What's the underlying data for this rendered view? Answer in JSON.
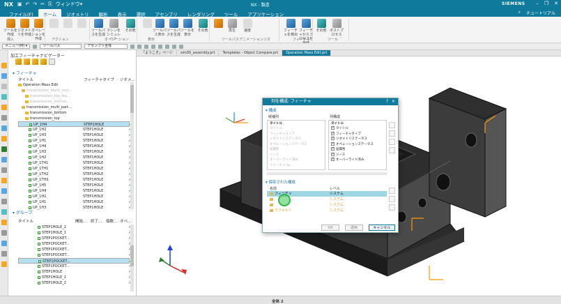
{
  "titlebar": {
    "logo": "NX",
    "window_menu": "ウィンドウ▾",
    "title": "NX - 製造",
    "brand": "SIEMENS"
  },
  "menu": {
    "tabs": [
      "ファイル(F)",
      "ホーム",
      "ジオメトリ",
      "解析",
      "表示",
      "選択",
      "アセンブリ",
      "レンダリング",
      "ツール",
      "アプリケーション"
    ],
    "active_index": 1,
    "right_tutorial": "チュートリアル"
  },
  "ribbon": {
    "buttons": [
      {
        "label": "ツールを作成",
        "color": "orange"
      },
      {
        "label": "ジオメトリを作成",
        "color": "orange"
      },
      {
        "label": "オペレーションを作成",
        "color": "orange"
      },
      {
        "label": "",
        "color": "dim"
      },
      {
        "label": "",
        "color": "dim"
      },
      {
        "label": "",
        "color": "dim"
      },
      {
        "label": "ツールパスを生成",
        "color": "blue"
      },
      {
        "label": "マシンをシミュレート",
        "color": "grey"
      },
      {
        "label": "その他",
        "color": "teal"
      },
      {
        "label": "",
        "color": "dim"
      },
      {
        "label": "ツールパス表示",
        "color": "blue"
      },
      {
        "label": "ツールパスを生成",
        "color": "blue"
      },
      {
        "label": "ツールを表示",
        "color": "blue"
      },
      {
        "label": "その他",
        "color": "teal"
      },
      {
        "label": "",
        "color": "orange"
      },
      {
        "label": "再生",
        "color": "grey"
      },
      {
        "label": "速度",
        "color": "dim"
      },
      {
        "label": "フィーチャを検出",
        "color": "blue"
      },
      {
        "label": "フィーチャからプロセスを作成",
        "color": "blue"
      },
      {
        "label": "その他",
        "color": "teal"
      },
      {
        "label": "ポストプロセス",
        "color": "grey"
      }
    ],
    "groups": [
      "挿入",
      "アクション",
      "オペレーション",
      "表示",
      "ツールパスアニメーション",
      "ジオ",
      "フィーチャ",
      "ツール"
    ]
  },
  "filterbar": {
    "menu_label": "メニュー(M) ▾",
    "filter_value": "ツールパス",
    "assembly_value": "アセンブリ全体"
  },
  "navigator": {
    "title": "加工フィーチャナビゲーター",
    "feature_section": "フィーチャ",
    "columns": {
      "name": "タイトル",
      "type": "フィーチャタイプ",
      "status": "ジオメ..."
    },
    "rows": [
      {
        "name": "Operation Mass Edit",
        "type": "",
        "style": "normal",
        "indent": 0,
        "check": false,
        "selected": false
      },
      {
        "name": "transmission_blank_mul...",
        "type": "",
        "style": "dim",
        "indent": 1,
        "check": false,
        "selected": false
      },
      {
        "name": "transmission_top_bla...",
        "type": "",
        "style": "dim",
        "indent": 2,
        "check": false,
        "selected": false
      },
      {
        "name": "transmission_bottom...",
        "type": "",
        "style": "dim",
        "indent": 2,
        "check": false,
        "selected": false
      },
      {
        "name": "transmission_multi_part...",
        "type": "",
        "style": "normal",
        "indent": 1,
        "check": false,
        "selected": false
      },
      {
        "name": "transmission_bottom",
        "type": "",
        "style": "normal",
        "indent": 2,
        "check": false,
        "selected": false
      },
      {
        "name": "transmission_top",
        "type": "",
        "style": "normal",
        "indent": 2,
        "check": false,
        "selected": false
      },
      {
        "name": "UP_1H4",
        "type": "STEP1HOLE",
        "style": "normal",
        "indent": 3,
        "check": true,
        "selected": true
      },
      {
        "name": "UP_1H2",
        "type": "STEP1HOLE",
        "style": "normal",
        "indent": 3,
        "check": true,
        "selected": false
      },
      {
        "name": "UP_1H3",
        "type": "STEP1HOLE",
        "style": "normal",
        "indent": 3,
        "check": true,
        "selected": false
      },
      {
        "name": "UP_1H1",
        "type": "STEP1HOLE",
        "style": "normal",
        "indent": 3,
        "check": true,
        "selected": false
      },
      {
        "name": "UP_1H4",
        "type": "STEP1HOLE",
        "style": "normal",
        "indent": 3,
        "check": true,
        "selected": false
      },
      {
        "name": "UP_1H3",
        "type": "STEP1HOLE",
        "style": "normal",
        "indent": 3,
        "check": true,
        "selected": false
      },
      {
        "name": "UP_1H2",
        "type": "STEP1HOLE",
        "style": "normal",
        "indent": 3,
        "check": true,
        "selected": false
      },
      {
        "name": "UP_1TH1",
        "type": "STEP1HOLE",
        "style": "normal",
        "indent": 3,
        "check": true,
        "selected": false
      },
      {
        "name": "UP_1TH1",
        "type": "STEP1HOLE",
        "style": "normal",
        "indent": 3,
        "check": true,
        "selected": false
      },
      {
        "name": "UP_1TH2",
        "type": "STEP1HOLE",
        "style": "normal",
        "indent": 3,
        "check": true,
        "selected": false
      },
      {
        "name": "UP_1TH3",
        "type": "STEP1HOLE",
        "style": "normal",
        "indent": 3,
        "check": true,
        "selected": false
      },
      {
        "name": "UP_1H5",
        "type": "STEP1HOLE",
        "style": "normal",
        "indent": 3,
        "check": true,
        "selected": false
      },
      {
        "name": "UP_1H4",
        "type": "STEP1HOLE",
        "style": "normal",
        "indent": 3,
        "check": true,
        "selected": false
      },
      {
        "name": "UP_1H2",
        "type": "STEP1HOLE",
        "style": "normal",
        "indent": 3,
        "check": true,
        "selected": false
      },
      {
        "name": "UP_1H1",
        "type": "STEP1HOLE",
        "style": "normal",
        "indent": 3,
        "check": true,
        "selected": false
      },
      {
        "name": "UP_1H3",
        "type": "STEP1HOLE",
        "style": "normal",
        "indent": 3,
        "check": true,
        "selected": false
      }
    ],
    "group_section": "グループ",
    "group_columns": {
      "name": "タイトル",
      "c1": "開始...",
      "c2": "終了...",
      "c3": "個数...",
      "c4": "オペ..."
    },
    "group_rows": [
      {
        "name": "STEP1HOLE_2",
        "selected": false
      },
      {
        "name": "STEP1HOLE_1",
        "selected": false
      },
      {
        "name": "STEP1POCKET...",
        "selected": false
      },
      {
        "name": "STEP1POCKET...",
        "selected": false
      },
      {
        "name": "STEP1POCKET...",
        "selected": false
      },
      {
        "name": "STEP1POCKET...",
        "selected": false
      },
      {
        "name": "STEP1POCKET...",
        "selected": true
      },
      {
        "name": "STEP1POCKET...",
        "selected": false
      },
      {
        "name": "STEP1HOLE",
        "selected": false
      },
      {
        "name": "STEP1HOLE_1",
        "selected": false
      },
      {
        "name": "STEP1HOLE_2",
        "selected": false
      }
    ]
  },
  "viewport_tabs": [
    {
      "label": "「ようこそ」ページ",
      "active": false
    },
    {
      "label": "sim05_assembly.prt",
      "active": false
    },
    {
      "label": "Templates - Object Compare.prt",
      "active": false
    },
    {
      "label": "Operation Mass Edit.prt",
      "active": true
    }
  ],
  "dialog": {
    "title": "列を構成: フィーチャ",
    "section": "構成",
    "left_header": "候補列",
    "left_col": "タイトル",
    "left_items": [
      "タイトル",
      "フィーチャタイプ",
      "ジオメトリステータス",
      "オペレーションステータス",
      "従属性",
      "ソース",
      "オーバーライド済み",
      "フィーチャ Sp..."
    ],
    "right_header": "列構成",
    "right_col": "タイトル",
    "right_items": [
      "タイトル",
      "フィーチャタイプ",
      "ジオメトリステータス",
      "オペレーションステータス",
      "従属性",
      "ソース",
      "オーバーライド済み"
    ],
    "saved_header": "保存された構成",
    "saved_cols": {
      "name": "名前",
      "level": "レベル"
    },
    "saved_rows": [
      {
        "name": "フィーチャ",
        "level": "システム",
        "selected": true
      },
      {
        "name": "",
        "level": "システム",
        "selected": false
      },
      {
        "name": "",
        "level": "システム",
        "selected": false
      },
      {
        "name": "デフォルト",
        "level": "システム",
        "selected": false
      }
    ],
    "ok": "OK",
    "apply": "適用",
    "cancel": "キャンセル"
  },
  "status": {
    "center_text": "全体 2"
  }
}
